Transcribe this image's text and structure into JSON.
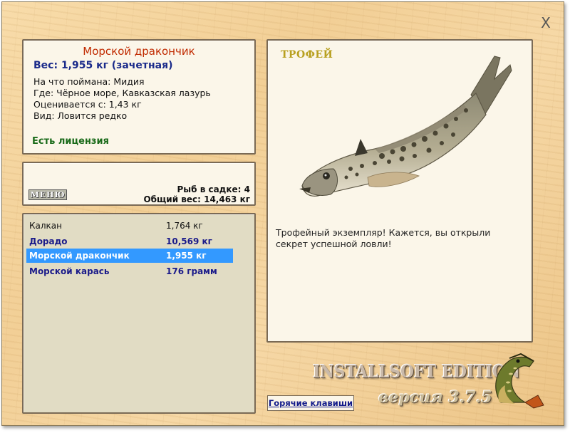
{
  "window": {
    "close_label": "X"
  },
  "fish_info": {
    "name": "Морской дракончик",
    "weight": "Вес: 1,955 кг (зачетная)",
    "caught_on": "На что поймана: Мидия",
    "location": "Где: Чёрное море, Кавказская лазурь",
    "valued_from": "Оценивается с: 1,43 кг",
    "type": "Вид: Ловится редко",
    "license": "Есть лицензия"
  },
  "summary": {
    "menu_label": "МЕНЮ",
    "fish_count": "Рыб в садке: 4",
    "total_weight": "Общий вес: 14,463 кг"
  },
  "catch_list": [
    {
      "name": "Калкан",
      "weight": "1,764 кг",
      "style": "normal"
    },
    {
      "name": "Дорадо",
      "weight": "10,569 кг",
      "style": "bold"
    },
    {
      "name": "Морской дракончик",
      "weight": "1,955 кг",
      "style": "selected"
    },
    {
      "name": "Морской карась",
      "weight": "176 грамм",
      "style": "bold"
    }
  ],
  "trophy": {
    "title": "ТРОФЕЙ",
    "text": "Трофейный экземпляр! Кажется, вы открыли секрет успешной ловли!",
    "image_icon": "weever-fish-image"
  },
  "branding": {
    "edition": "INSTALLSOFT EDITION",
    "version": "версия 3.7.5",
    "logo_icon": "pike-logo"
  },
  "footer": {
    "hotkeys_label": "Горячие клавиши"
  },
  "colors": {
    "fish_name": "#c02a00",
    "weight_text": "#1a2a8a",
    "license_text": "#1a6b1a",
    "selection": "#3399ff",
    "trophy_title": "#b8a020"
  }
}
